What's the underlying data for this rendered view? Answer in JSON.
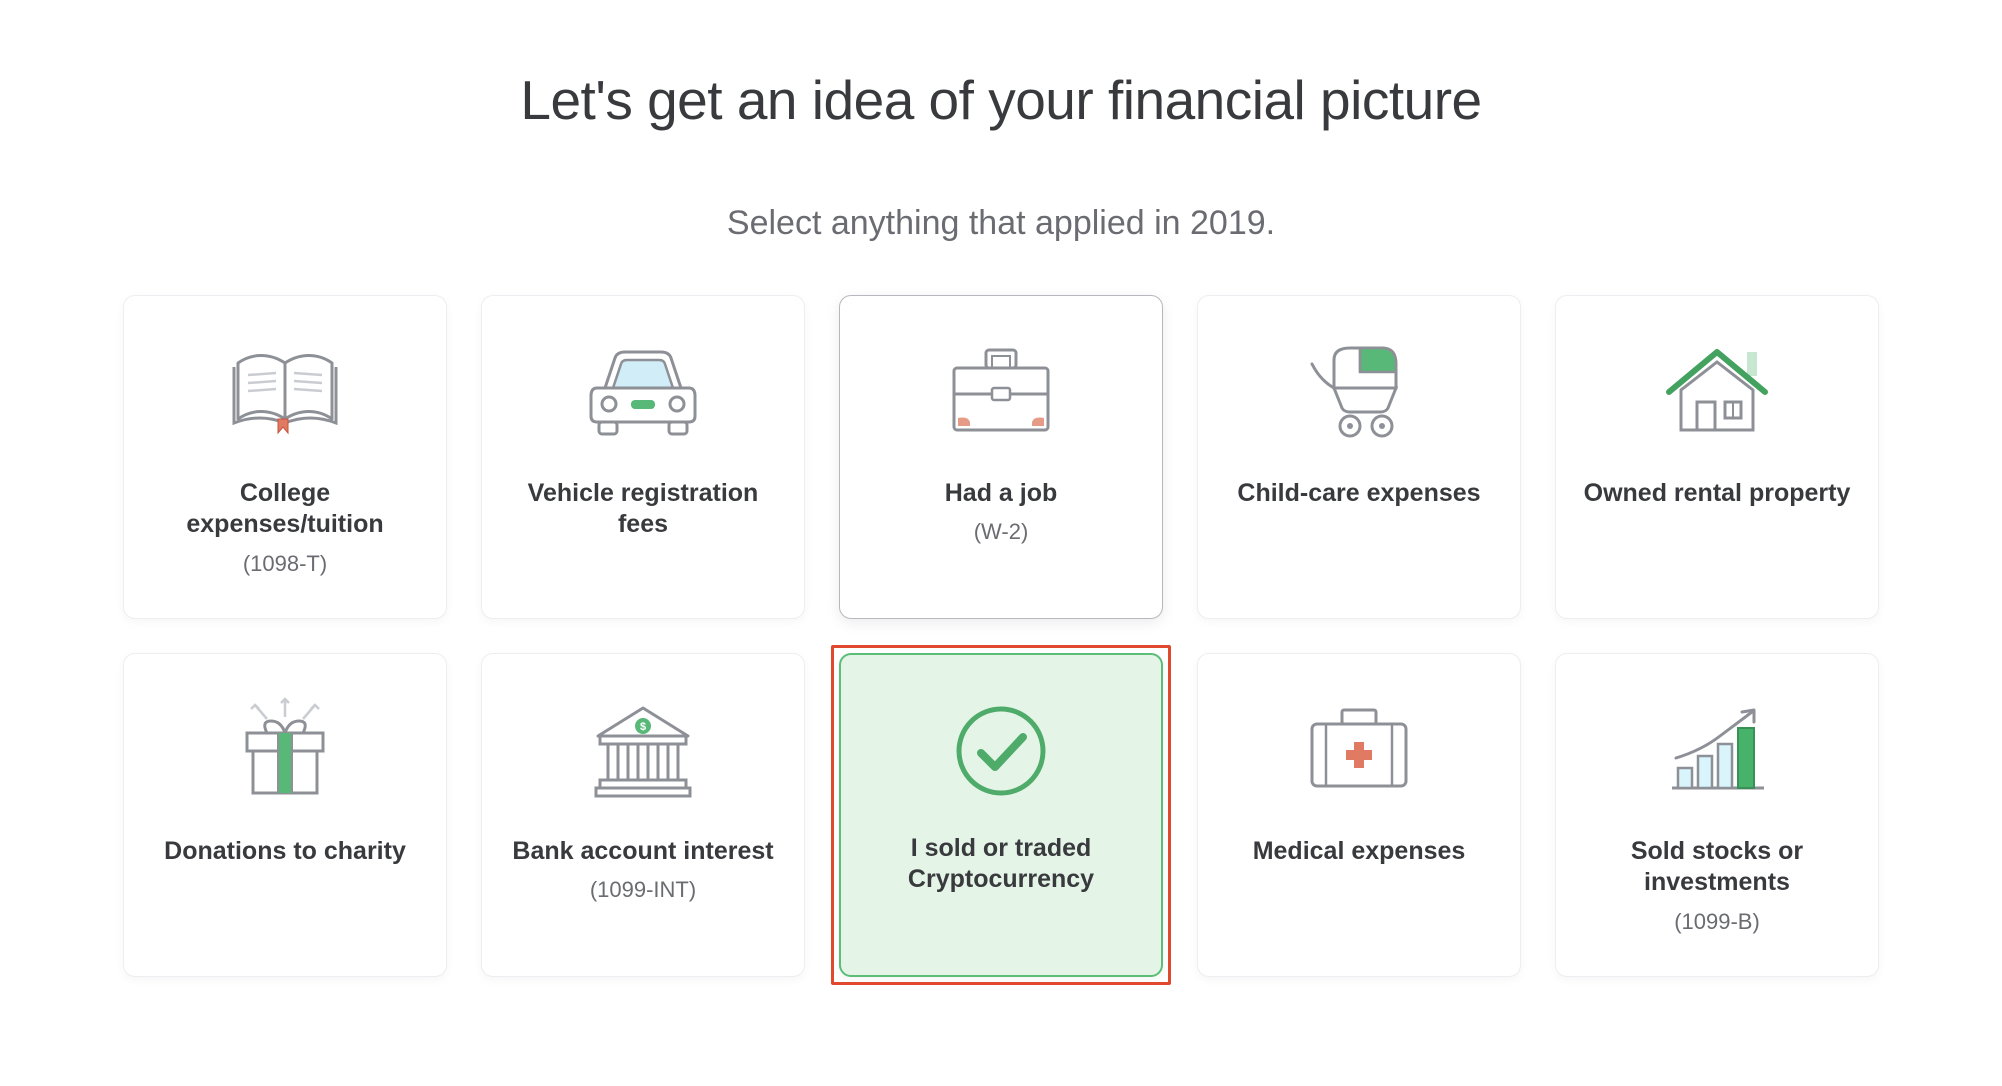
{
  "heading": "Let's get an idea of your financial picture",
  "subheading": "Select anything that applied in 2019.",
  "cards": [
    {
      "label": "College expenses/tuition",
      "sublabel": "(1098-T)"
    },
    {
      "label": "Vehicle registration fees",
      "sublabel": ""
    },
    {
      "label": "Had a job",
      "sublabel": "(W-2)"
    },
    {
      "label": "Child-care expenses",
      "sublabel": ""
    },
    {
      "label": "Owned rental property",
      "sublabel": ""
    },
    {
      "label": "Donations to charity",
      "sublabel": ""
    },
    {
      "label": "Bank account interest",
      "sublabel": "(1099-INT)"
    },
    {
      "label": "I sold or traded Cryptocurrency",
      "sublabel": ""
    },
    {
      "label": "Medical expenses",
      "sublabel": ""
    },
    {
      "label": "Sold stocks or investments",
      "sublabel": "(1099-B)"
    }
  ]
}
